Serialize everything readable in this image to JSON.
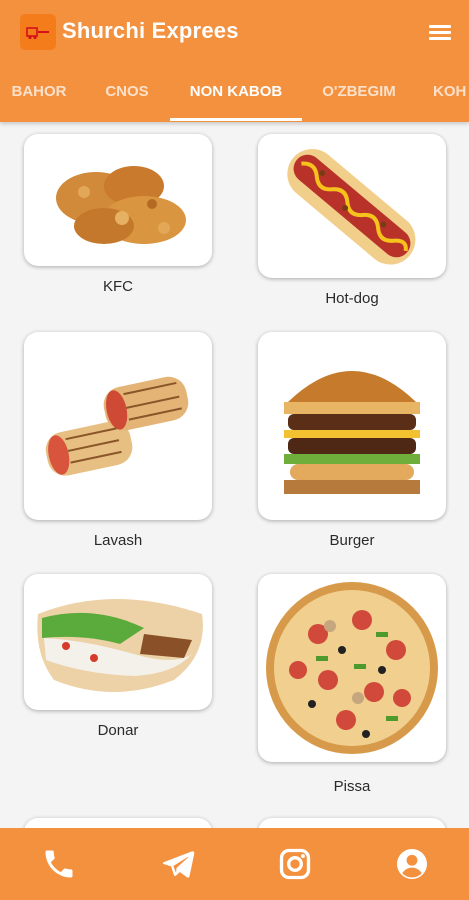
{
  "app": {
    "title": "Shurchi Exprees",
    "accent": "#f4913f"
  },
  "tabs": [
    {
      "label": "BAHOR",
      "active": false
    },
    {
      "label": "CNOS",
      "active": false
    },
    {
      "label": "NON KABOB",
      "active": true
    },
    {
      "label": "O'ZBEGIM",
      "active": false
    },
    {
      "label": "KOH",
      "active": false
    }
  ],
  "products": [
    {
      "name": "KFC",
      "icon": "fried-chicken"
    },
    {
      "name": "Hot-dog",
      "icon": "hot-dog"
    },
    {
      "name": "Lavash",
      "icon": "lavash-wrap"
    },
    {
      "name": "Burger",
      "icon": "burger"
    },
    {
      "name": "Donar",
      "icon": "donar-pita"
    },
    {
      "name": "Pissa",
      "icon": "pizza"
    }
  ],
  "bottom_nav": [
    "phone-icon",
    "telegram-icon",
    "instagram-icon",
    "profile-icon"
  ]
}
